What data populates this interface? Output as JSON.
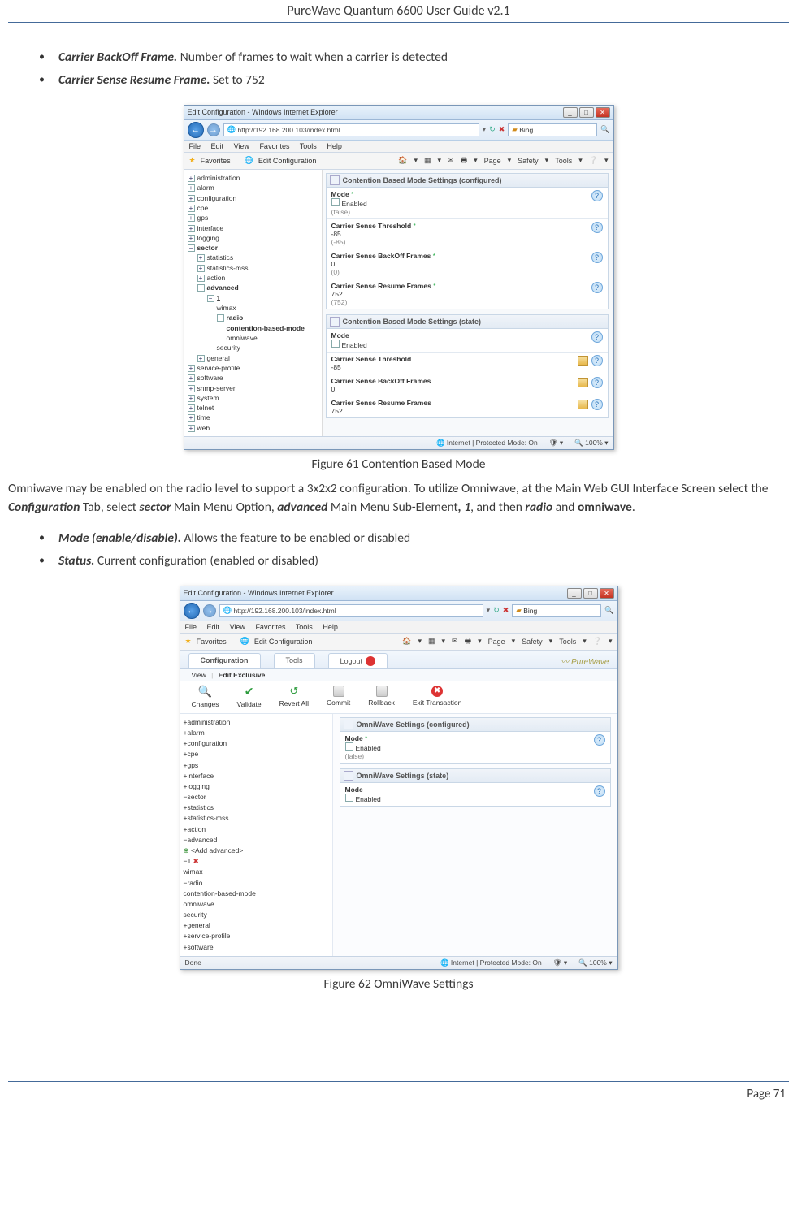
{
  "doc": {
    "header_title": "PureWave Quantum 6600 User Guide v2.1",
    "page_label": "Page 71"
  },
  "bullets1": [
    {
      "term": "Carrier BackOff Frame.",
      "text": " Number of frames to wait when a carrier is detected"
    },
    {
      "term": "Carrier Sense Resume Frame.",
      "text": " Set to 752"
    }
  ],
  "fig61": {
    "caption": "Figure 61 Contention Based Mode"
  },
  "para1": {
    "pre": "Omniwave may be enabled on the radio level to support a 3x2x2 configuration.  To utilize Omniwave, at the Main Web GUI Interface Screen select the ",
    "cfg": "Configuration",
    "mid1": " Tab, select ",
    "sector": "sector",
    "mid2": " Main Menu Option, ",
    "adv": "advanced",
    "mid3": " Main Menu Sub-Element",
    "one": ", 1",
    "mid4": ", and then ",
    "radio": "radio",
    "mid5": " and ",
    "omni": "omniwave",
    "end": "."
  },
  "bullets2": [
    {
      "term": "Mode (enable/disable).",
      "text": "  Allows the feature to be enabled or disabled"
    },
    {
      "term": "Status.",
      "text": " Current configuration (enabled or disabled)"
    }
  ],
  "fig62": {
    "caption": "Figure 62 OmniWave Settings"
  },
  "ie": {
    "title": "Edit Configuration - Windows Internet Explorer",
    "url": "http://192.168.200.103/index.html",
    "search": "Bing",
    "menus": [
      "File",
      "Edit",
      "View",
      "Favorites",
      "Tools",
      "Help"
    ],
    "fav_label": "Favorites",
    "tab_label": "Edit Configuration",
    "cmd": {
      "page": "Page",
      "safety": "Safety",
      "tools": "Tools"
    },
    "status": {
      "zone": "Internet | Protected Mode: On",
      "zoom": "100%"
    }
  },
  "shot1": {
    "tree": [
      "administration",
      "alarm",
      "configuration",
      "cpe",
      "gps",
      "interface",
      "logging"
    ],
    "sector_children": [
      "statistics",
      "statistics-mss",
      "action"
    ],
    "adv_children": [
      "wimax"
    ],
    "radio_children": [
      "contention-based-mode",
      "omniwave"
    ],
    "after_radio": [
      "security"
    ],
    "after_sector": [
      "general",
      "service-profile",
      "software",
      "snmp-server",
      "system",
      "telnet",
      "time",
      "web"
    ],
    "grp1": "Contention Based Mode Settings (configured)",
    "rows1": [
      {
        "label": "Mode",
        "req": "*",
        "check_label": "Enabled",
        "sub": "(false)"
      },
      {
        "label": "Carrier Sense Threshold",
        "req": "*",
        "val": "-85",
        "sub": "(-85)"
      },
      {
        "label": "Carrier Sense BackOff Frames",
        "req": "*",
        "val": "0",
        "sub": "(0)"
      },
      {
        "label": "Carrier Sense Resume Frames",
        "req": "*",
        "val": "752",
        "sub": "(752)"
      }
    ],
    "grp2": "Contention Based Mode Settings (state)",
    "rows2": [
      {
        "label": "Mode",
        "check_label": "Enabled"
      },
      {
        "label": "Carrier Sense Threshold",
        "val": "-85"
      },
      {
        "label": "Carrier Sense BackOff Frames",
        "val": "0"
      },
      {
        "label": "Carrier Sense Resume Frames",
        "val": "752"
      }
    ]
  },
  "shot2": {
    "tabs": {
      "conf": "Configuration",
      "tools": "Tools",
      "logout": "Logout"
    },
    "brand": "PureWave",
    "subtabs": {
      "view": "View",
      "edit": "Edit Exclusive"
    },
    "toolbar": [
      "Changes",
      "Validate",
      "Revert All",
      "Commit",
      "Rollback",
      "Exit Transaction"
    ],
    "tree_top": [
      "administration",
      "alarm",
      "configuration",
      "cpe",
      "gps",
      "interface",
      "logging"
    ],
    "sector_children": [
      "statistics",
      "statistics-mss",
      "action"
    ],
    "add_adv": "<Add advanced>",
    "one": "1",
    "adv_children": [
      "wimax"
    ],
    "radio_children": [
      "contention-based-mode",
      "omniwave"
    ],
    "after_radio": [
      "security"
    ],
    "after_sector": [
      "general",
      "service-profile",
      "software"
    ],
    "grp1": "OmniWave Settings (configured)",
    "row1": {
      "label": "Mode",
      "req": "*",
      "check_label": "Enabled",
      "sub": "(false)"
    },
    "grp2": "OmniWave Settings (state)",
    "row2": {
      "label": "Mode",
      "check_label": "Enabled"
    },
    "status_done": "Done"
  }
}
